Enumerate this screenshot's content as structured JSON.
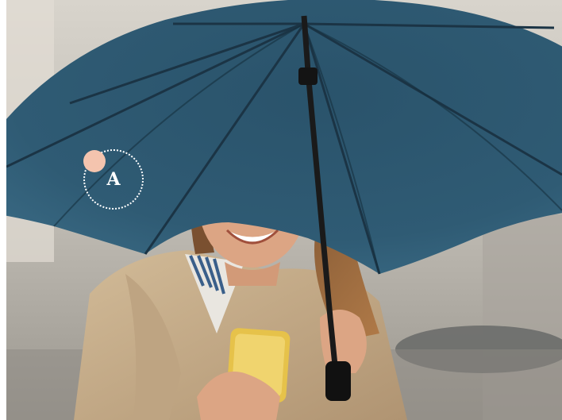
{
  "photo": {
    "description_icon": "umbrella-icon",
    "colors": {
      "umbrella": "#2f5a72",
      "umbrella_dark": "#1f3f53",
      "coat": "#c9b08e",
      "skin": "#d9a27f",
      "hair": "#8a5a34",
      "phone": "#e6c24a",
      "background": "#c9c6c0"
    }
  },
  "hotspot": {
    "label": "A",
    "dot_color": "#f4c4ae",
    "ring_color": "#ffffff"
  }
}
